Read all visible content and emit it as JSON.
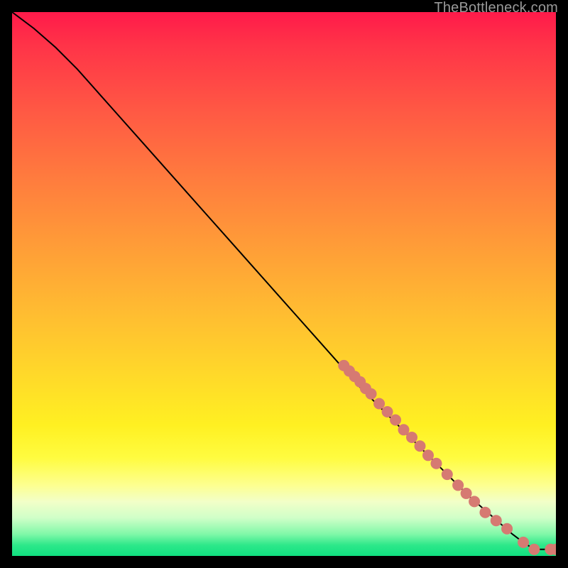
{
  "attribution": "TheBottleneck.com",
  "chart_data": {
    "type": "line",
    "title": "",
    "xlabel": "",
    "ylabel": "",
    "xlim": [
      0,
      100
    ],
    "ylim": [
      0,
      100
    ],
    "series": [
      {
        "name": "curve",
        "x": [
          0,
          4,
          8,
          12,
          16,
          20,
          24,
          28,
          32,
          36,
          40,
          44,
          48,
          52,
          56,
          60,
          64,
          68,
          72,
          76,
          80,
          84,
          88,
          92,
          94,
          96,
          100
        ],
        "y": [
          100,
          97,
          93.5,
          89.5,
          85,
          80.5,
          76,
          71.5,
          67,
          62.5,
          58,
          53.5,
          49,
          44.5,
          40,
          35.5,
          31,
          27,
          23,
          19,
          15,
          11,
          7.5,
          4,
          2.5,
          1.2,
          1.2
        ]
      }
    ],
    "markers": [
      {
        "x": 61,
        "y": 35
      },
      {
        "x": 62,
        "y": 34
      },
      {
        "x": 63,
        "y": 33
      },
      {
        "x": 64,
        "y": 32
      },
      {
        "x": 65,
        "y": 30.8
      },
      {
        "x": 66,
        "y": 29.8
      },
      {
        "x": 67.5,
        "y": 28
      },
      {
        "x": 69,
        "y": 26.5
      },
      {
        "x": 70.5,
        "y": 25
      },
      {
        "x": 72,
        "y": 23.2
      },
      {
        "x": 73.5,
        "y": 21.8
      },
      {
        "x": 75,
        "y": 20.2
      },
      {
        "x": 76.5,
        "y": 18.5
      },
      {
        "x": 78,
        "y": 17
      },
      {
        "x": 80,
        "y": 15
      },
      {
        "x": 82,
        "y": 13
      },
      {
        "x": 83.5,
        "y": 11.5
      },
      {
        "x": 85,
        "y": 10
      },
      {
        "x": 87,
        "y": 8
      },
      {
        "x": 89,
        "y": 6.5
      },
      {
        "x": 91,
        "y": 5
      },
      {
        "x": 94,
        "y": 2.5
      },
      {
        "x": 96,
        "y": 1.2
      },
      {
        "x": 99,
        "y": 1.2
      },
      {
        "x": 100,
        "y": 1.2
      }
    ],
    "marker_color": "#d67a72",
    "line_color": "#000000"
  }
}
